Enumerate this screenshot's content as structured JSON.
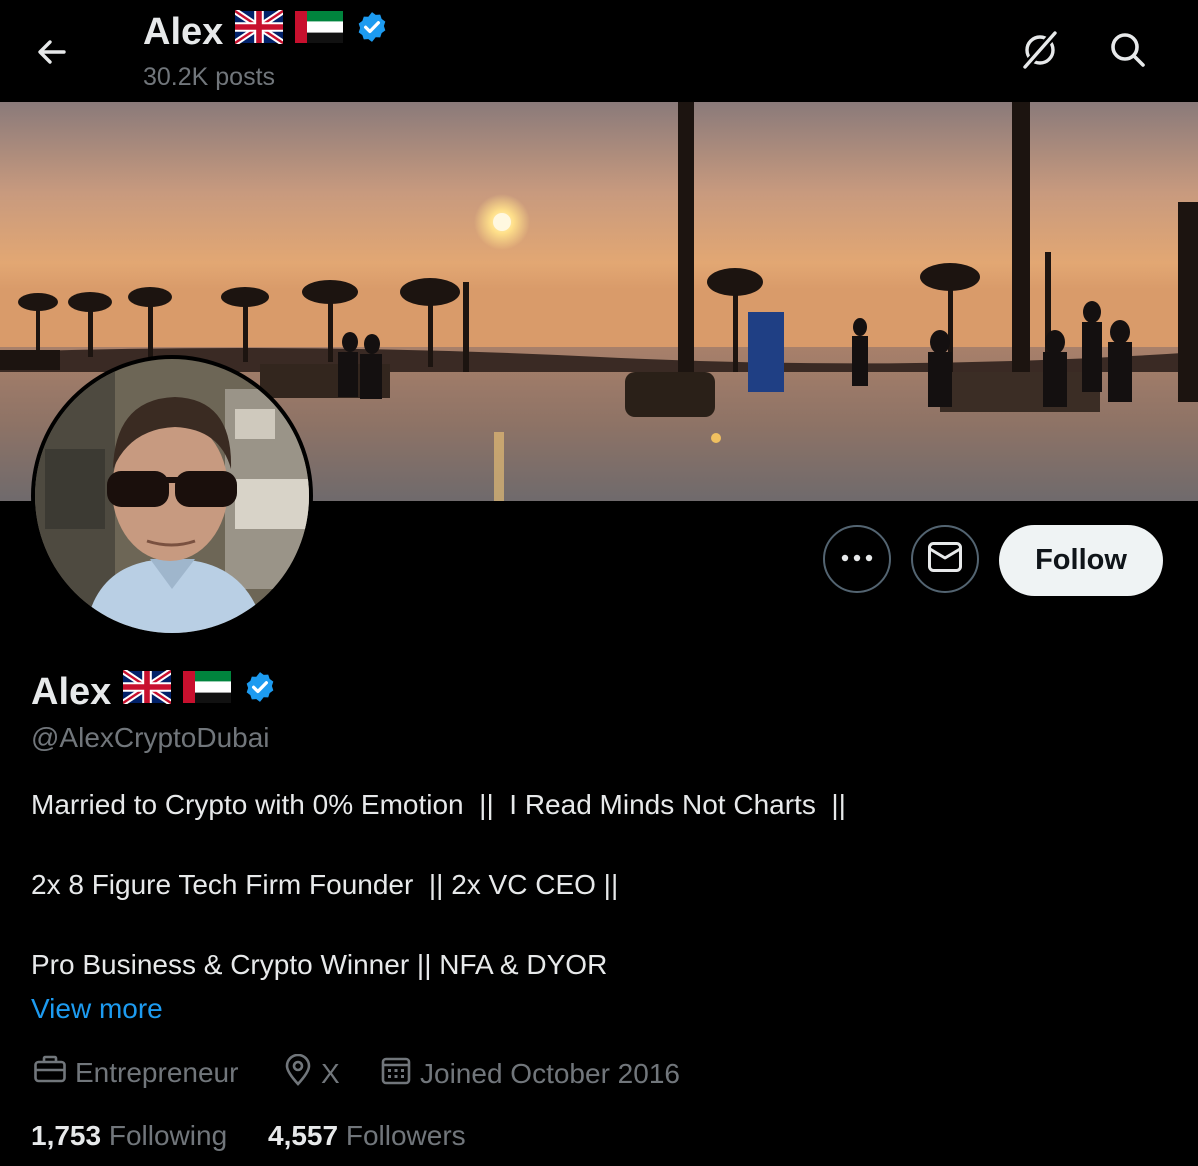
{
  "header": {
    "name": "Alex",
    "posts": "30.2K posts"
  },
  "profile": {
    "name": "Alex",
    "handle": "@AlexCryptoDubai",
    "follow_label": "Follow",
    "bio": [
      "Married to Crypto with 0% Emotion  ||  I Read Minds Not Charts  ||",
      "2x 8 Figure Tech Firm Founder  || 2x VC CEO ||",
      "Pro Business & Crypto Winner || NFA & DYOR"
    ],
    "view_more": "View more",
    "meta": {
      "profession": "Entrepreneur",
      "location": "X",
      "joined": "Joined October 2016"
    },
    "stats": {
      "following_count": "1,753",
      "following_label": "Following",
      "followers_count": "4,557",
      "followers_label": "Followers"
    }
  },
  "icons": [
    "back-arrow-icon",
    "grok-icon",
    "search-icon",
    "more-icon",
    "mail-icon",
    "verified-badge-icon",
    "briefcase-icon",
    "location-pin-icon",
    "calendar-icon",
    "uk-flag-icon",
    "uae-flag-icon"
  ],
  "colors": {
    "background": "#000000",
    "primary_text": "#e7e9ea",
    "secondary_text": "#71767b",
    "link": "#1d9bf0",
    "verified": "#1d9bf0",
    "follow_bg": "#eff3f4"
  }
}
